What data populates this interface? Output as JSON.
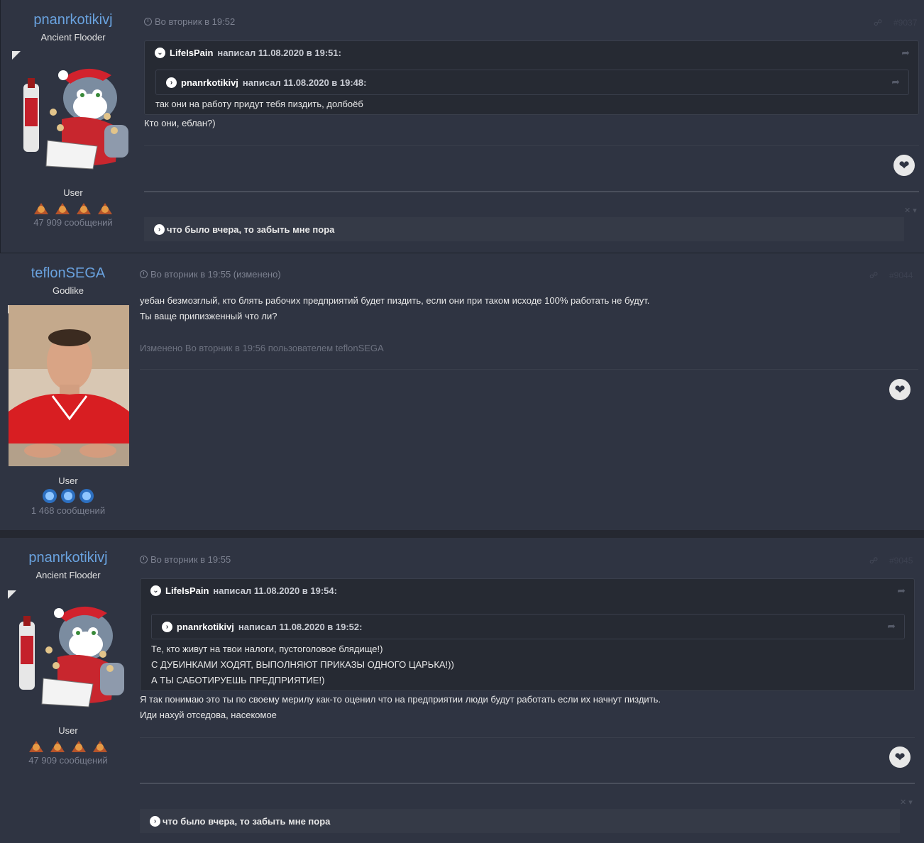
{
  "posts": [
    {
      "author": "pnanrkotikivj",
      "rank": "Ancient Flooder",
      "group": "User",
      "count": "47 909 сообщений",
      "time": "Во вторник в 19:52",
      "number": "#9037",
      "quote_outer": {
        "user": "LifeIsPain",
        "meta": "написал 11.08.2020 в 19:51:",
        "text": [
          "так они на работу придут тебя пиздить, долбоёб"
        ]
      },
      "quote_inner": {
        "user": "pnanrkotikivj",
        "meta": "написал 11.08.2020 в 19:48:"
      },
      "body": [
        "Кто они, еблан?)"
      ],
      "signature": "что было вчера, то забыть мне пора"
    },
    {
      "author": "teflonSEGA",
      "rank": "Godlike",
      "group": "User",
      "count": "1 468 сообщений",
      "time": "Во вторник в 19:55 (изменено)",
      "number": "#9044",
      "body": [
        "уебан безмозглый, кто блять рабочих предприятий будет пиздить, если они при таком исходе 100% работать не будут.",
        "Ты ваще припизженный что ли?"
      ],
      "edited": "Изменено Во вторник в 19:56 пользователем teflonSEGA"
    },
    {
      "author": "pnanrkotikivj",
      "rank": "Ancient Flooder",
      "group": "User",
      "count": "47 909 сообщений",
      "time": "Во вторник в 19:55",
      "number": "#9045",
      "quote_outer": {
        "user": "LifeIsPain",
        "meta": "написал 11.08.2020 в 19:54:",
        "text": [
          "Те, кто живут на твои налоги, пустоголовое блядище!)",
          "С ДУБИНКАМИ ХОДЯТ, ВЫПОЛНЯЮТ ПРИКАЗЫ ОДНОГО ЦАРЬКА!))",
          "А ТЫ САБОТИРУЕШЬ ПРЕДПРИЯТИЕ!)"
        ]
      },
      "quote_inner": {
        "user": "pnanrkotikivj",
        "meta": "написал 11.08.2020 в 19:52:"
      },
      "body": [
        "Я так понимаю это ты по своему мерилу как-то оценил что на предприятии люди будут работать если их начнут пиздить.",
        "Иди нахуй отседова, насекомое"
      ],
      "signature": "что было вчера, то забыть мне пора"
    }
  ],
  "icons": {
    "like": "heart-icon",
    "share": "share-icon",
    "quote": "quote-icon",
    "close": "close-icon",
    "clock": "clock-icon"
  },
  "colors": {
    "accent": "#6aa3e0",
    "background": "#2f3442",
    "quote_bg": "#262a33"
  }
}
